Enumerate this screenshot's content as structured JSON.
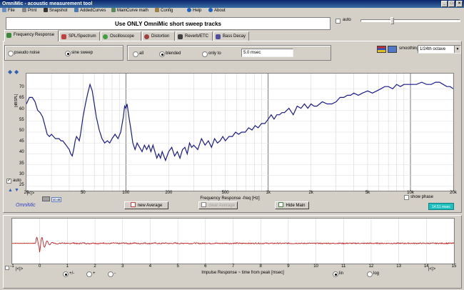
{
  "window": {
    "title": "OmniMic - acoustic measurement tool"
  },
  "menu": [
    "File",
    "Print",
    "Snapshot",
    "AddedCurves",
    "MainCurve math",
    "Config",
    "Help",
    "About"
  ],
  "top_right": {
    "auto_label": "auto"
  },
  "banner": "Use ONLY OmniMic short sweep tracks",
  "tabs": [
    "Frequency Response",
    "SPL/Spectrum",
    "Oscilloscope",
    "Distortion",
    "Reverb/ETC",
    "Bass Decay"
  ],
  "signal": {
    "options": [
      "pseudo noise",
      "sine sweep"
    ],
    "selected": "sine sweep"
  },
  "gating": {
    "options": [
      "all",
      "blended",
      "only to"
    ],
    "selected": "blended",
    "time_value": "5.0 msec"
  },
  "smoothing": {
    "label": "smoothing",
    "value": "1/24th octave"
  },
  "freq_chart": {
    "ylabel": "[dBSPL]",
    "yticks": [
      70,
      65,
      60,
      55,
      50,
      45,
      40,
      35,
      30,
      25
    ],
    "ylim": [
      23,
      77
    ],
    "xticks": [
      "20",
      "50",
      "100",
      "200",
      "500",
      "1k",
      "2k",
      "5k",
      "10k",
      "20k"
    ],
    "xtick_values": [
      20,
      50,
      100,
      200,
      500,
      1000,
      2000,
      5000,
      10000,
      20000
    ],
    "xlabel": "Frequency Response  -freq [Hz]",
    "auto_label": "auto",
    "show_phase_label": "show phase",
    "delay_value": "14.51 msec",
    "brand": "OmniMic"
  },
  "chart_data": {
    "type": "line",
    "xscale": "log",
    "xlim": [
      20,
      20000
    ],
    "ylim": [
      23,
      77
    ],
    "x": [
      20,
      21,
      22,
      23,
      24,
      25,
      26,
      27,
      28,
      29,
      30,
      31,
      32,
      33,
      34,
      35,
      36,
      37,
      38,
      39,
      40,
      41,
      42,
      43,
      44,
      45,
      46,
      47,
      48,
      50,
      52,
      54,
      56,
      58,
      60,
      62,
      65,
      68,
      71,
      74,
      77,
      80,
      84,
      88,
      92,
      96,
      98,
      100,
      102,
      105,
      108,
      112,
      116,
      120,
      125,
      130,
      135,
      140,
      145,
      150,
      155,
      160,
      165,
      170,
      175,
      180,
      190,
      200,
      210,
      220,
      230,
      240,
      250,
      260,
      270,
      280,
      290,
      300,
      320,
      340,
      360,
      380,
      400,
      420,
      440,
      460,
      480,
      500,
      530,
      560,
      590,
      620,
      650,
      690,
      730,
      770,
      810,
      850,
      900,
      950,
      1000,
      1050,
      1100,
      1150,
      1200,
      1250,
      1300,
      1400,
      1500,
      1600,
      1700,
      1800,
      1900,
      2000,
      2100,
      2200,
      2400,
      2600,
      2800,
      3000,
      3200,
      3400,
      3600,
      3800,
      4000,
      4300,
      4600,
      5000,
      5400,
      5800,
      6200,
      6600,
      7000,
      7500,
      8000,
      8500,
      9000,
      9500,
      10000,
      11000,
      12000,
      13000,
      14000,
      15000,
      16000,
      17000,
      18000,
      19000,
      20000
    ],
    "y": [
      63,
      66,
      66,
      64,
      60,
      59,
      57,
      53,
      49,
      48,
      49,
      48,
      47,
      47,
      47,
      46,
      46,
      45,
      44,
      43,
      42,
      40,
      39,
      42,
      46,
      48,
      47,
      46,
      49,
      57,
      63,
      68,
      72,
      69,
      63,
      57,
      51,
      47,
      45,
      46,
      45,
      47,
      49,
      47,
      50,
      57,
      62,
      61,
      63,
      57,
      52,
      45,
      42,
      45,
      43,
      41,
      44,
      42,
      44,
      41,
      44,
      41,
      38,
      40,
      38,
      41,
      37,
      41,
      43,
      39,
      41,
      38,
      42,
      43,
      40,
      45,
      43,
      44,
      42,
      47,
      44,
      46,
      43,
      47,
      45,
      46,
      48,
      46,
      48,
      48,
      50,
      49,
      50,
      50,
      52,
      51,
      53,
      52,
      54,
      54,
      56,
      58,
      56,
      58,
      58,
      59,
      59,
      61,
      58,
      62,
      61,
      63,
      61,
      63,
      62,
      62,
      64,
      63,
      63,
      64,
      66,
      66,
      67,
      67,
      68,
      67,
      68,
      69,
      68,
      69,
      70,
      71,
      71,
      70,
      72,
      71,
      72,
      72,
      72,
      72,
      73,
      72,
      72,
      73,
      73,
      72,
      71,
      71,
      70
    ]
  },
  "freq_buttons": {
    "new_average": "new Average",
    "clear_average": "clear Average",
    "hide_main": "Hide Main"
  },
  "impulse_chart": {
    "xticks": [
      -1,
      0,
      1,
      2,
      3,
      4,
      5,
      6,
      7,
      8,
      9,
      10,
      11,
      12,
      13,
      14,
      15
    ],
    "xlabel": "Impulse Response  ~ time from peak [msec]",
    "polarity_options": [
      "+/-",
      "+",
      "-"
    ],
    "polarity_selected": "+/-",
    "scale_options": [
      "lin",
      "log"
    ],
    "scale_selected": "lin"
  },
  "colors": {
    "curve": "#1a1a8c",
    "impulse": "#c02020",
    "accent": "#0a246a"
  }
}
